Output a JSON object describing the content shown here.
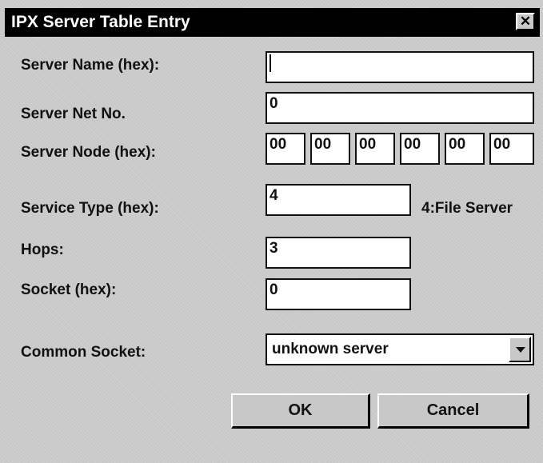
{
  "window": {
    "title": "IPX Server Table Entry",
    "close_glyph": "✕"
  },
  "fields": {
    "server_name": {
      "label": "Server Name (hex):",
      "value": ""
    },
    "server_net_no": {
      "label": "Server Net No.",
      "value": "0"
    },
    "server_node": {
      "label": "Server Node (hex):",
      "values": [
        "00",
        "00",
        "00",
        "00",
        "00",
        "00"
      ]
    },
    "service_type": {
      "label": "Service Type (hex):",
      "value": "4",
      "description": "4:File Server"
    },
    "hops": {
      "label": "Hops:",
      "value": "3"
    },
    "socket": {
      "label": "Socket (hex):",
      "value": "0"
    },
    "common_socket": {
      "label": "Common Socket:",
      "selected": "unknown server"
    }
  },
  "buttons": {
    "ok": "OK",
    "cancel": "Cancel"
  },
  "icons": {
    "close": "close-icon",
    "dropdown": "chevron-down-icon"
  },
  "colors": {
    "titlebar": "#000000",
    "dialog_bg": "#c8c8c8",
    "field_bg": "#ffffff"
  }
}
